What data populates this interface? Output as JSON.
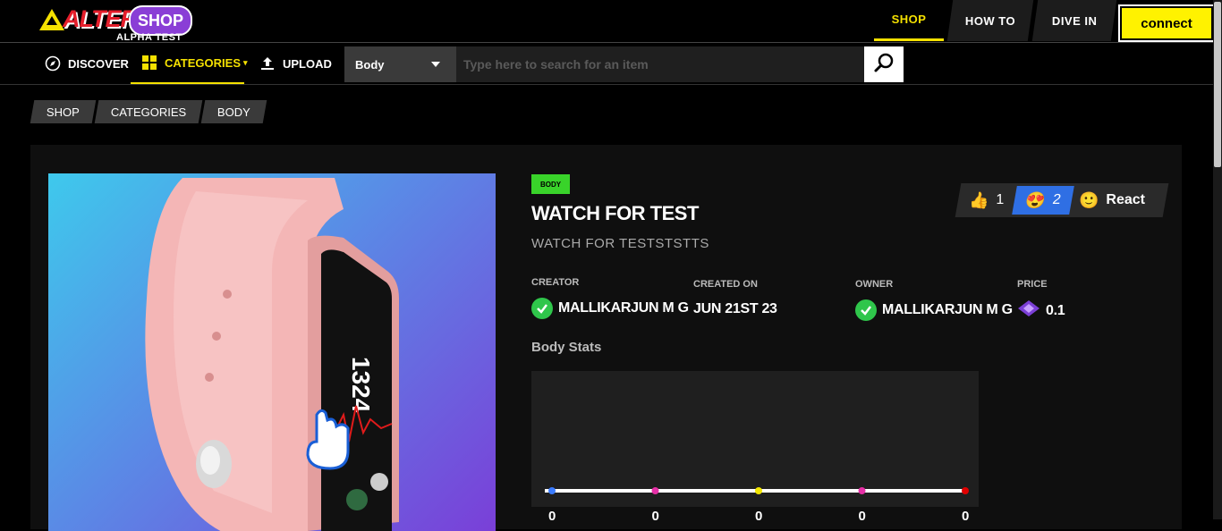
{
  "brand": {
    "name": "ALTER",
    "badge": "SHOP",
    "subtitle": "ALPHA TEST"
  },
  "topnav": {
    "shop": "SHOP",
    "howto": "HOW TO",
    "dive": "DIVE IN",
    "connect": "connect"
  },
  "subnav": {
    "discover": "DISCOVER",
    "categories": "CATEGORIES",
    "upload": "UPLOAD"
  },
  "search": {
    "category": "Body",
    "placeholder": "Type here to search for an item"
  },
  "breadcrumb": [
    "SHOP",
    "CATEGORIES",
    "BODY"
  ],
  "product": {
    "category_badge": "BODY",
    "title": "WATCH FOR TEST",
    "subtitle": "WATCH FOR TESTSTSTTS",
    "creator_label": "CREATOR",
    "creator": "MALLIKARJUN M G",
    "created_label": "CREATED ON",
    "created": "JUN 21ST 23",
    "owner_label": "OWNER",
    "owner": "MALLIKARJUN M G",
    "price_label": "PRICE",
    "price": "0.1",
    "stats_label": "Body Stats",
    "stats_values": [
      "0",
      "0",
      "0",
      "0",
      "0"
    ],
    "stats_dot_colors": [
      "#3a7bff",
      "#e62fa6",
      "#f2e600",
      "#e62fa6",
      "#e00000"
    ]
  },
  "reactions": {
    "likes": "1",
    "hearts": "2",
    "react_label": "React"
  },
  "colors": {
    "accent": "#f5e100",
    "connect": "#fff200",
    "badge_green": "#39d32a",
    "reaction_active": "#2f6fe4"
  }
}
